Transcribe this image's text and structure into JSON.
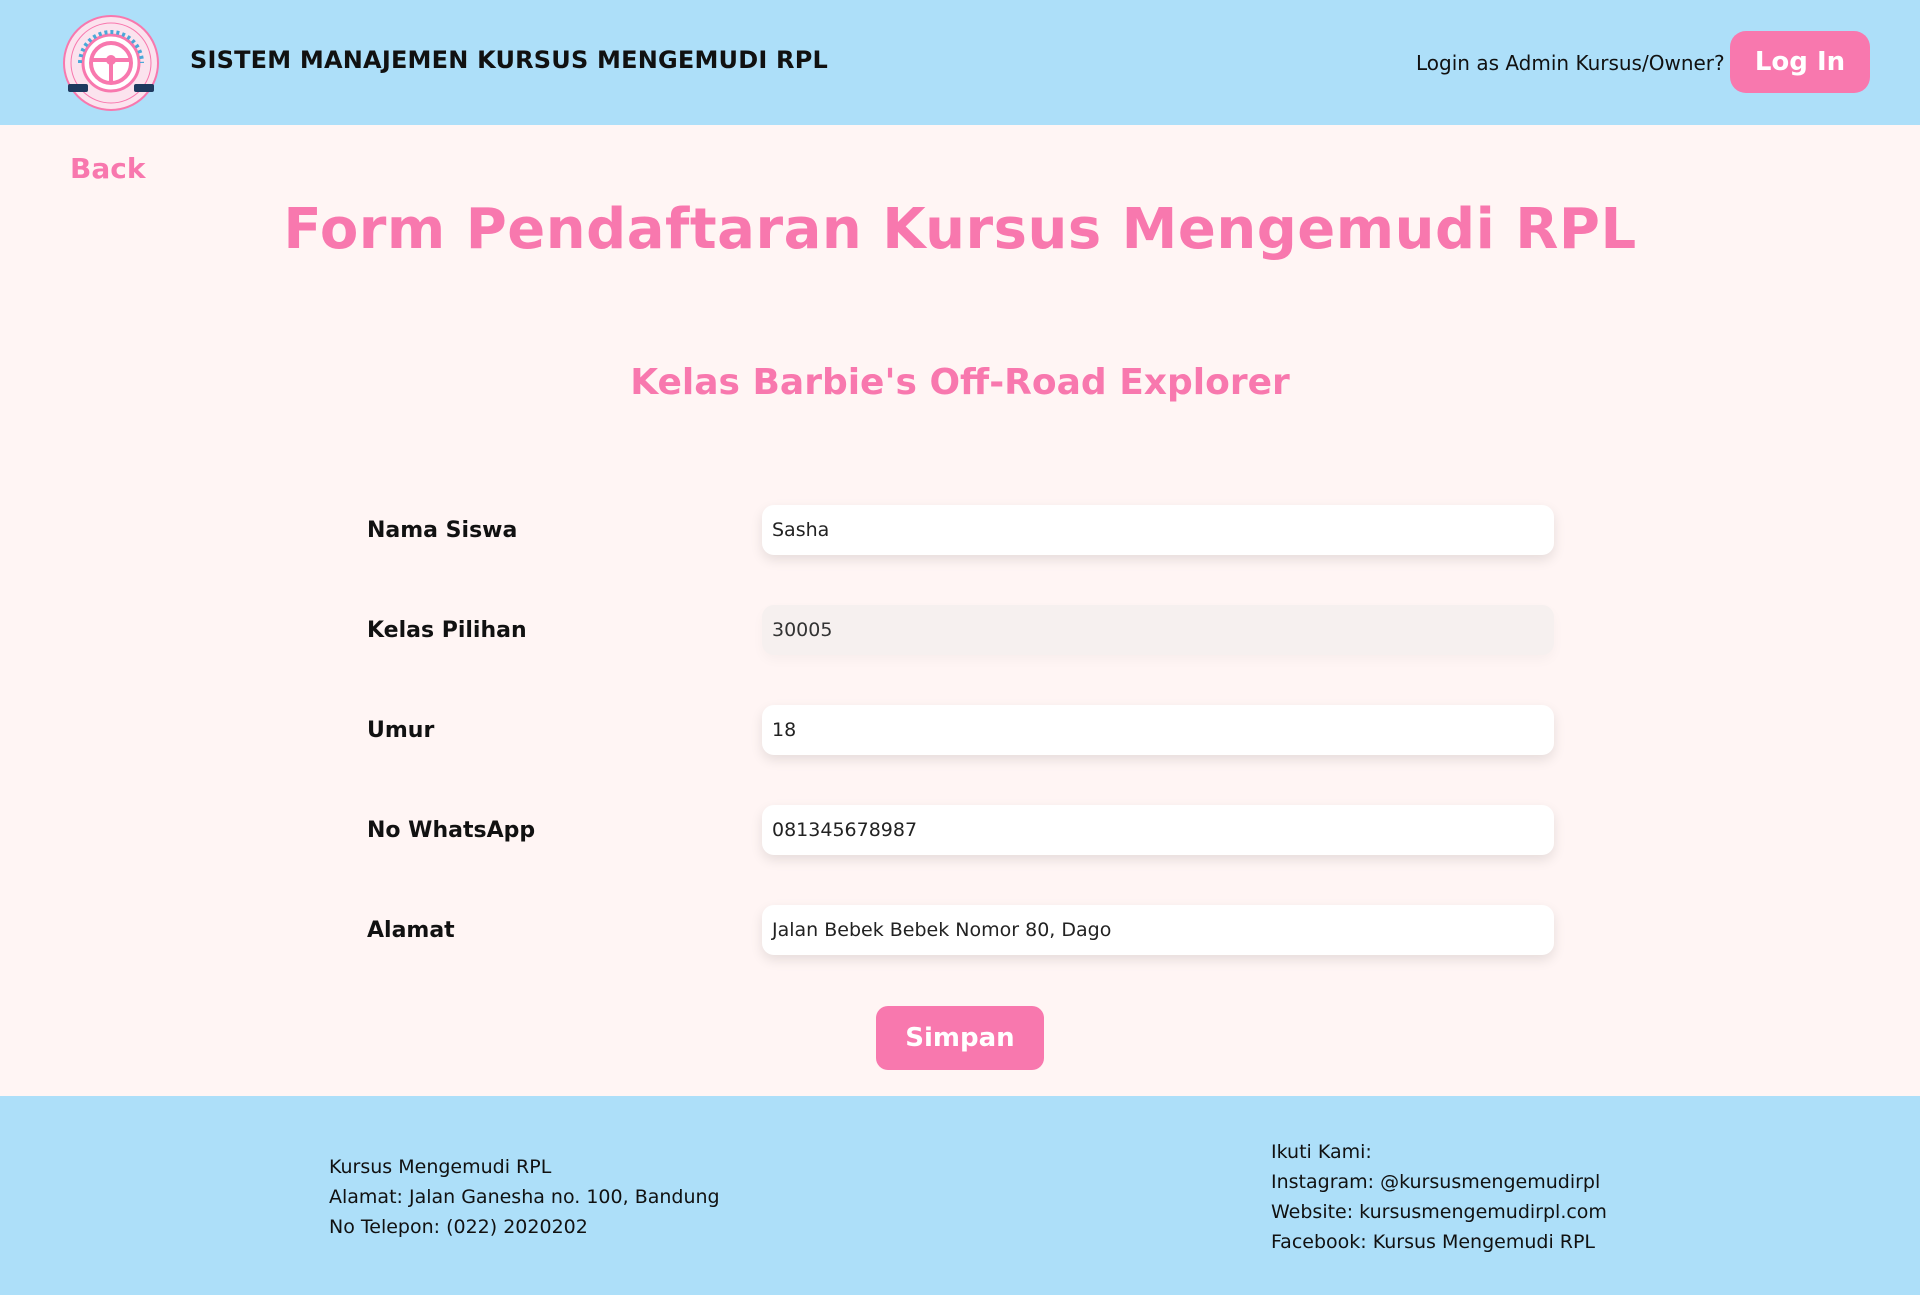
{
  "colors": {
    "accent": "#f878ae",
    "header_bg": "#addff9",
    "page_bg": "#fff5f4"
  },
  "header": {
    "logo_icon": "steering-wheel-logo",
    "logo_text": "KURSUS MENGEMUDI RPL",
    "title": "SISTEM MANAJEMEN KURSUS MENGEMUDI RPL",
    "login_prompt": "Login as Admin Kursus/Owner?",
    "login_button": "Log In"
  },
  "nav": {
    "back_label": "Back"
  },
  "main": {
    "title": "Form Pendaftaran Kursus Mengemudi RPL",
    "class_title": "Kelas Barbie's Off-Road Explorer"
  },
  "form": {
    "fields": [
      {
        "label": "Nama Siswa",
        "value": "Sasha"
      },
      {
        "label": "Kelas Pilihan",
        "value": "30005"
      },
      {
        "label": "Umur",
        "value": "18"
      },
      {
        "label": "No WhatsApp",
        "value": "081345678987"
      },
      {
        "label": "Alamat",
        "value": "Jalan Bebek Bebek Nomor 80, Dago"
      }
    ],
    "submit_label": "Simpan"
  },
  "footer": {
    "left": {
      "name": "Kursus Mengemudi RPL",
      "address": "Alamat: Jalan Ganesha no. 100, Bandung",
      "phone": "No Telepon: (022) 2020202"
    },
    "right": {
      "heading": "Ikuti Kami:",
      "instagram": "Instagram: @kursusmengemudirpl",
      "website": "Website: kursusmengemudirpl.com",
      "facebook": "Facebook: Kursus Mengemudi RPL"
    }
  }
}
